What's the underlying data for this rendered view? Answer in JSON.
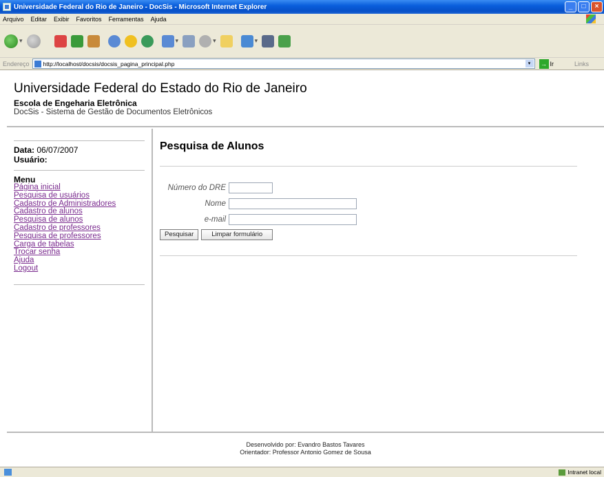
{
  "window": {
    "title": "Universidade Federal do Rio de Janeiro - DocSis - Microsoft Internet Explorer"
  },
  "menubar": [
    "Arquivo",
    "Editar",
    "Exibir",
    "Favoritos",
    "Ferramentas",
    "Ajuda"
  ],
  "address": {
    "label": "Endereço",
    "url": "http://localhost/docsis/docsis_pagina_principal.php",
    "go": "Ir",
    "links": "Links"
  },
  "header": {
    "university": "Universidade Federal do Estado do Rio de Janeiro",
    "school": "Escola de Engeharia Eletrônica",
    "system": "DocSis - Sistema de Gestão de Documentos Eletrônicos"
  },
  "sidebar": {
    "date_label": "Data:",
    "date_value": "06/07/2007",
    "user_label": "Usuário:",
    "menu_title": "Menu",
    "items": [
      "Página inicial",
      "Pesquisa de usuários",
      "Cadastro de Administradores",
      "Cadastro de alunos",
      "Pesquisa de alunos",
      "Cadastro de professores",
      "Pesquisa de professores",
      "Carga de tabelas",
      "Trocar senha",
      "Ajuda",
      "Logout"
    ]
  },
  "main": {
    "title": "Pesquisa de Alunos",
    "fields": {
      "dre_label": "Número do DRE",
      "dre_value": "",
      "name_label": "Nome",
      "name_value": "",
      "email_label": "e-mail",
      "email_value": ""
    },
    "search_button": "Pesquisar",
    "clear_button": "Limpar formulário"
  },
  "footer": {
    "line1": "Desenvolvido por: Evandro Bastos Tavares",
    "line2": "Orientador: Professor Antonio Gomez de Sousa"
  },
  "status": {
    "zone": "Intranet local"
  },
  "colors": {
    "titlebar": "#0a5fdc",
    "link": "#7a2a8e",
    "chrome": "#ece9d8"
  }
}
